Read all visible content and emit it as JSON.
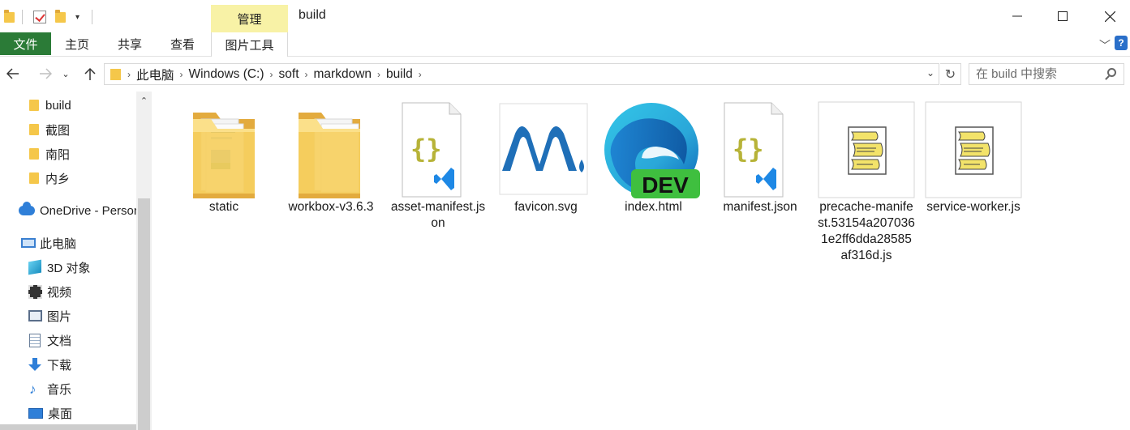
{
  "window": {
    "title": "build",
    "manage_tab": "管理"
  },
  "ribbon": {
    "tabs": [
      "文件",
      "主页",
      "共享",
      "查看",
      "图片工具"
    ]
  },
  "address": {
    "crumbs": [
      "此电脑",
      "Windows (C:)",
      "soft",
      "markdown",
      "build"
    ],
    "search_placeholder": "在 build 中搜索"
  },
  "nav": {
    "items": [
      "build",
      "截图",
      "南阳",
      "内乡",
      "OneDrive - Personal",
      "此电脑",
      "3D 对象",
      "视频",
      "图片",
      "文档",
      "下载",
      "音乐",
      "桌面"
    ]
  },
  "files": [
    {
      "name": "static",
      "icon": "folder-icon"
    },
    {
      "name": "workbox-v3.6.3",
      "icon": "folder-icon"
    },
    {
      "name": "asset-manifest.json",
      "icon": "json-file-icon"
    },
    {
      "name": "favicon.svg",
      "icon": "svg-thumbnail"
    },
    {
      "name": "index.html",
      "icon": "edge-dev-icon",
      "badge": "DEV"
    },
    {
      "name": "manifest.json",
      "icon": "json-file-icon"
    },
    {
      "name": "precache-manifest.53154a2070361e2ff6dda28585af316d.js",
      "icon": "script-file-icon"
    },
    {
      "name": "service-worker.js",
      "icon": "script-file-icon"
    }
  ]
}
